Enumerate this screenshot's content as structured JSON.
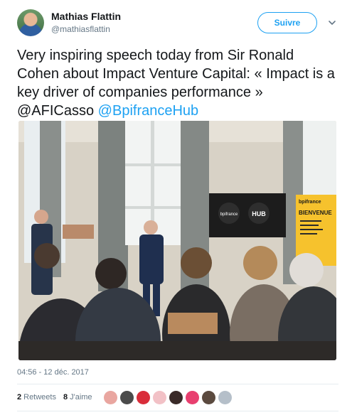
{
  "author": {
    "name": "Mathias Flattin",
    "handle": "@mathiasflattin"
  },
  "follow_button": {
    "label": "Suivre"
  },
  "tweet": {
    "text": "Very inspiring speech today from Sir Ronald Cohen about Impact Venture Capital: « Impact is a key driver of companies performance » @AFICasso ",
    "mention": "@BpifranceHub"
  },
  "photo": {
    "banner_title": "BIENVENUE",
    "banner_brand": "bpifrance",
    "screen_left": "bpifrance",
    "screen_right": "HUB"
  },
  "meta": {
    "timestamp": "04:56 - 12 déc. 2017"
  },
  "stats": {
    "retweets_count": "2",
    "retweets_label": "Retweets",
    "likes_count": "8",
    "likes_label": "J'aime"
  },
  "likers": [
    {
      "color": "#e9a6a0"
    },
    {
      "color": "#4b4b4b"
    },
    {
      "color": "#d92d3a"
    },
    {
      "color": "#f2c1c6"
    },
    {
      "color": "#3a2a28"
    },
    {
      "color": "#e83f6f"
    },
    {
      "color": "#5b4a3f"
    },
    {
      "color": "#b5bfc9"
    }
  ],
  "colors": {
    "accent": "#1da1f2",
    "muted": "#657786",
    "text": "#14171a"
  }
}
